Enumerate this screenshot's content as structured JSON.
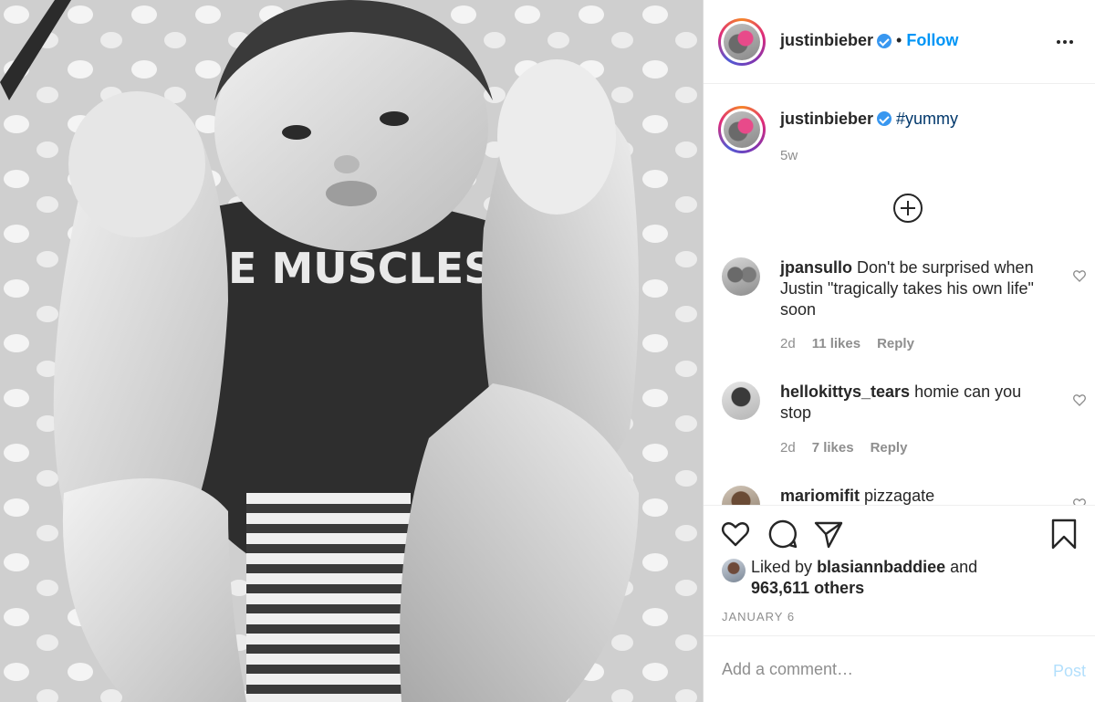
{
  "post": {
    "image_alt": "",
    "shirt_text": "E MUSCLES"
  },
  "header": {
    "username": "justinbieber",
    "separator": "•",
    "follow_label": "Follow"
  },
  "caption": {
    "username": "justinbieber",
    "text": "#yummy",
    "time": "5w"
  },
  "comments": [
    {
      "username": "jpansullo",
      "text": "Don't be surprised when Justin \"tragically takes his own life\" soon",
      "time": "2d",
      "likes": "11 likes",
      "reply": "Reply"
    },
    {
      "username": "hellokittys_tears",
      "text": "homie can you stop",
      "time": "2d",
      "likes": "7 likes",
      "reply": "Reply"
    },
    {
      "username": "mariomifit",
      "text": "pizzagate",
      "time": "",
      "likes": "",
      "reply": ""
    }
  ],
  "likes": {
    "prefix": "Liked by",
    "liker": "blasiannbaddiee",
    "joiner": "and",
    "others": "963,611 others"
  },
  "date": "JANUARY 6",
  "add_comment": {
    "placeholder": "Add a comment…",
    "post_label": "Post"
  },
  "colors": {
    "link_blue": "#0095f6",
    "hashtag_blue": "#00376b",
    "muted": "#8e8e8e",
    "post_disabled": "#b2dffc"
  },
  "icons": [
    "more-options-icon",
    "verified-badge-icon",
    "load-more-comments-icon",
    "heart-icon",
    "comment-icon",
    "share-icon",
    "bookmark-icon"
  ]
}
